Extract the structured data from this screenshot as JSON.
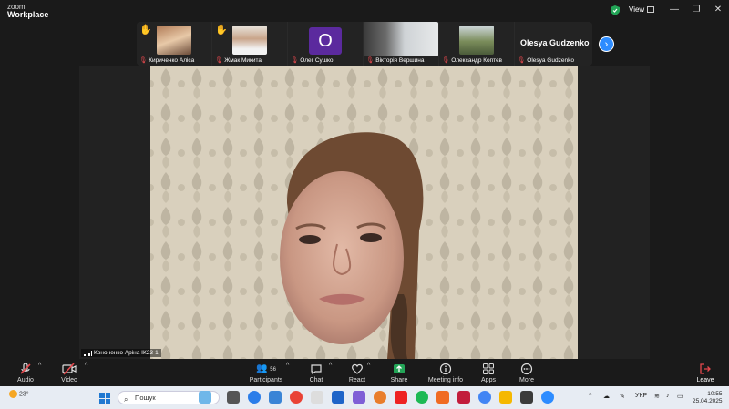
{
  "app": {
    "logo_line1": "zoom",
    "logo_line2": "Workplace",
    "view_label": "View"
  },
  "window_controls": {
    "minimize": "—",
    "maximize": "❐",
    "close": "✕"
  },
  "participants": [
    {
      "name": "Кириченко Аліса",
      "hand_raised": true,
      "muted": true
    },
    {
      "name": "Жмак Микита",
      "hand_raised": true,
      "muted": true
    },
    {
      "name": "Олег Сушко",
      "avatar_letter": "O",
      "muted": true
    },
    {
      "name": "Вікторія Вершина",
      "muted": true
    },
    {
      "name": "Олександр Коптєв",
      "muted": true
    },
    {
      "name": "Olesya Gudzenko",
      "display_name": "Olesya Gudzenko",
      "muted": true
    }
  ],
  "speaker": {
    "name": "Кононенко Аріна ІК23-1"
  },
  "toolbar": {
    "audio": "Audio",
    "video": "Video",
    "participants": "Participants",
    "participants_count": "56",
    "chat": "Chat",
    "react": "React",
    "share": "Share",
    "meeting_info": "Meeting info",
    "apps": "Apps",
    "more": "More",
    "leave": "Leave"
  },
  "taskbar": {
    "temperature": "23°",
    "search_placeholder": "Пошук",
    "language": "УКР",
    "time": "10:55",
    "date": "25.04.2025"
  },
  "colors": {
    "accent": "#2d8cff",
    "share": "#23a557",
    "muted": "#e5484d",
    "leave": "#e5484d"
  }
}
